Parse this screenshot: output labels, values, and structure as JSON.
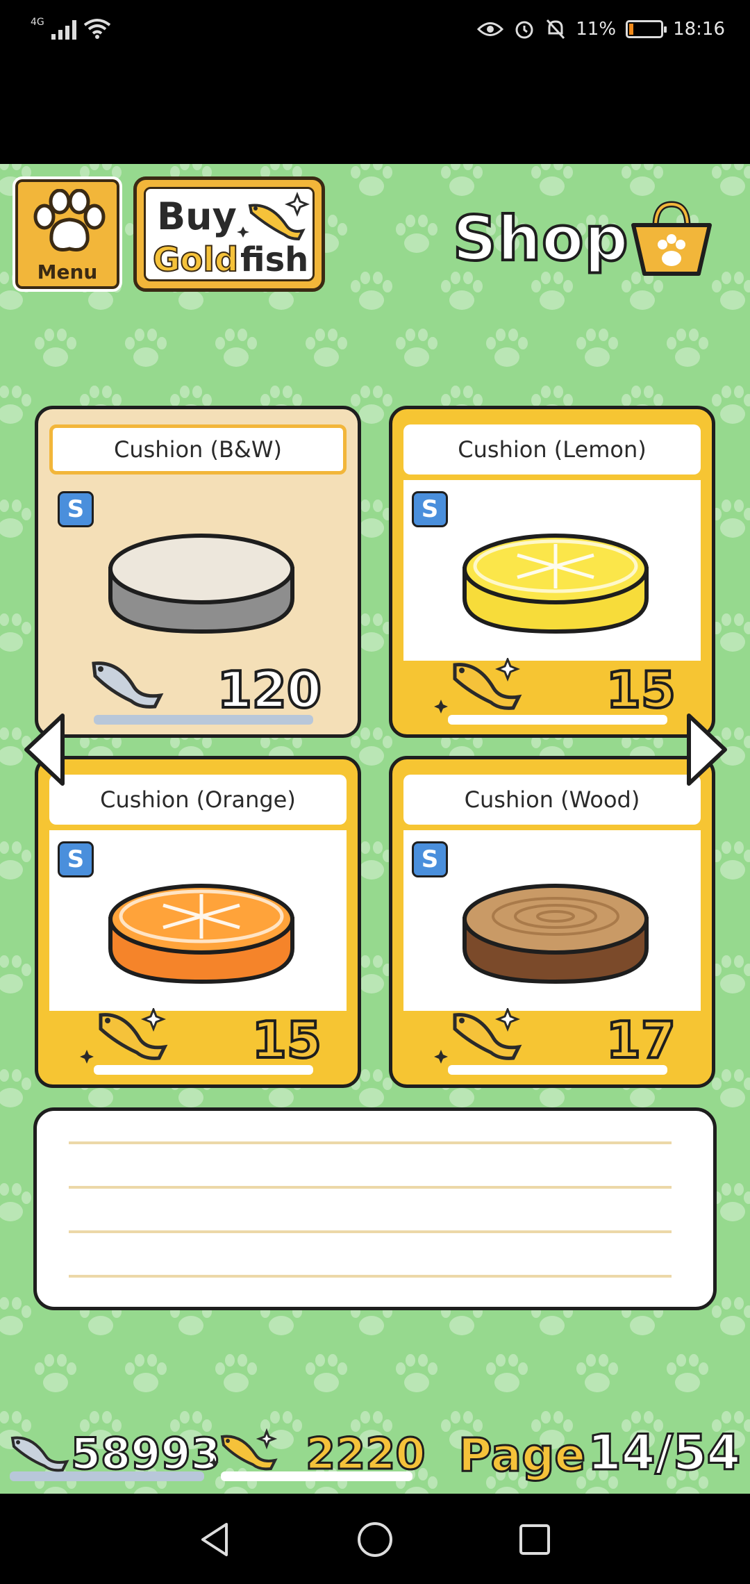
{
  "status_bar": {
    "network_type": "4G",
    "battery_percent_text": "11%",
    "battery_level": 0.11,
    "time": "18:16",
    "icons": [
      "signal-icon",
      "wifi-icon",
      "eye-icon",
      "alarm-icon",
      "mute-notifications-icon",
      "battery-icon"
    ]
  },
  "header": {
    "menu_label": "Menu",
    "buy_line1": "Buy",
    "buy_gold": "Gold",
    "buy_fish": "fish",
    "shop_title": "Shop"
  },
  "items": [
    {
      "name": "Cushion (B&W)",
      "badge": "S",
      "price": "120",
      "currency": "silver",
      "selected": true,
      "colors": {
        "top": "#ede7dc",
        "side": "#8e8e8e"
      }
    },
    {
      "name": "Cushion (Lemon)",
      "badge": "S",
      "price": "15",
      "currency": "gold",
      "selected": false,
      "colors": {
        "top": "#fbe64a",
        "side": "#f7dc3a"
      }
    },
    {
      "name": "Cushion (Orange)",
      "badge": "S",
      "price": "15",
      "currency": "gold",
      "selected": false,
      "colors": {
        "top": "#ffa33a",
        "side": "#f5842a"
      }
    },
    {
      "name": "Cushion (Wood)",
      "badge": "S",
      "price": "17",
      "currency": "gold",
      "selected": false,
      "colors": {
        "top": "#c99a66",
        "side": "#7b4a2a"
      }
    }
  ],
  "footer": {
    "silver_fish": "58993",
    "gold_fish": "2220",
    "page_label": "Page",
    "page_number": "14/54"
  },
  "colors": {
    "background_green": "#96d98e",
    "gold": "#f5c23a",
    "outline": "#1e1e1e",
    "selected_card": "#f4dfb7",
    "badge_blue": "#4a8fdc"
  }
}
